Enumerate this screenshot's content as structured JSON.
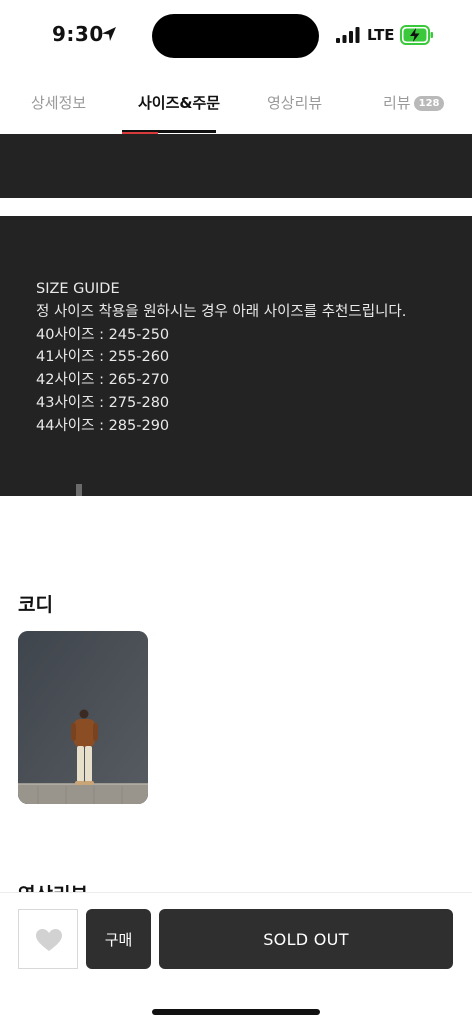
{
  "status_bar": {
    "time": "9:30",
    "network": "LTE",
    "icons": [
      "location-arrow-icon",
      "signal-icon",
      "battery-charging-icon"
    ]
  },
  "tabs": [
    {
      "label": "상세정보",
      "active": false
    },
    {
      "label": "사이즈&주문",
      "active": true
    },
    {
      "label": "영상리뷰",
      "active": false
    },
    {
      "label": "리뷰",
      "badge": "128",
      "active": false
    }
  ],
  "size_guide": {
    "lines": [
      "SIZE GUIDE",
      "정 사이즈 착용을 원하시는 경우 아래 사이즈를 추천드립니다.",
      "40사이즈 : 245-250",
      "41사이즈 : 255-260",
      "42사이즈 : 265-270",
      "43사이즈 : 275-280",
      "44사이즈 : 285-290"
    ]
  },
  "coordi": {
    "title": "코디"
  },
  "video_review": {
    "title": "영상리뷰"
  },
  "bottom_bar": {
    "like_icon": "heart-icon",
    "buy_label": "구매",
    "soldout_label": "SOLD OUT"
  },
  "colors": {
    "dark_panel": "#232323",
    "button_dark": "#2f2f2f",
    "accent_red": "#d93b3b",
    "battery_green": "#39c93b"
  }
}
